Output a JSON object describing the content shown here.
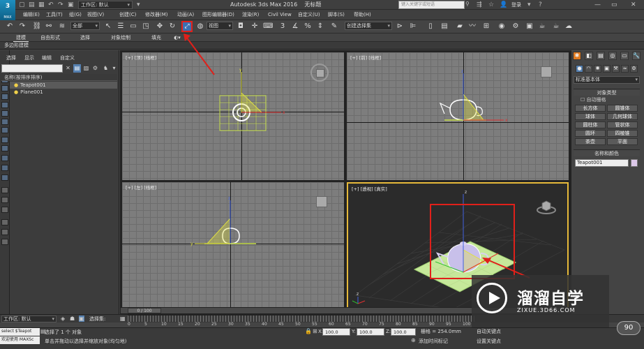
{
  "app": {
    "title": "Autodesk 3ds Max 2016",
    "doc_title": "无标题",
    "logo_text": "MAX",
    "workspace_label": "工作区: 默认",
    "search_placeholder": "键入关键字或短语",
    "login_label": "登录"
  },
  "menus": [
    "编辑(E)",
    "工具(T)",
    "组(G)",
    "视图(V)",
    "创建(C)",
    "修改器(M)",
    "动画(A)",
    "图形编辑器(D)",
    "渲染(R)",
    "Civil View",
    "自定义(U)",
    "脚本(S)",
    "帮助(H)"
  ],
  "toolbar": {
    "selection_filter": "全部",
    "ref_coord": "视图",
    "named_selection": "创建选择集",
    "highlighted_tool": "select-and-manipulate",
    "highlight_color": "#e0201a"
  },
  "ribbon": {
    "tabs": [
      "建模",
      "自由形式",
      "选择",
      "对象绘制",
      "填充"
    ],
    "active_tab": "建模",
    "sub_label": "多边形建模"
  },
  "scene_explorer": {
    "menu": [
      "选择",
      "显示",
      "编辑",
      "自定义"
    ],
    "column_header": "名称(按排序排序)",
    "items": [
      "Teapot001",
      "Plane001"
    ],
    "selected_item": "Teapot001"
  },
  "viewports": {
    "top": "[+] [顶] [线框]",
    "front": "[+] [前] [线框]",
    "left": "[+] [左] [线框]",
    "perspective": "[+] [透视] [真实]",
    "axis_labels": {
      "x": "x",
      "y": "y",
      "z": "z"
    },
    "active_border_color": "#e6b93a"
  },
  "command_panel": {
    "category": "标准基本体",
    "object_type_header": "对象类型",
    "autogrid_label": "自动栅格",
    "buttons": [
      "长方体",
      "圆锥体",
      "球体",
      "几何球体",
      "圆柱体",
      "管状体",
      "圆环",
      "四棱锥",
      "茶壶",
      "平面"
    ],
    "name_color_header": "名称和颜色",
    "object_name": "Teapot001",
    "object_color": "#dcc8e8"
  },
  "timeline": {
    "frame_indicator": "0 / 100",
    "ruler_ticks": [
      "0",
      "5",
      "10",
      "15",
      "20",
      "25",
      "30",
      "35",
      "40",
      "45",
      "50",
      "55",
      "60",
      "65",
      "70",
      "75",
      "80",
      "85",
      "90",
      "95",
      "100"
    ]
  },
  "status": {
    "maxscript_line1": "select $Teapot",
    "maxscript_line2": "欢迎使用 MAXSc",
    "selection_info": "选择了 1 个 对象",
    "prompt": "单击并拖动以选择并缩放对象(均匀地)",
    "x_label": "X:",
    "x_value": "100.0",
    "y_label": "Y:",
    "y_value": "100.0",
    "z_label": "Z:",
    "z_value": "100.0",
    "grid": "栅格 = 254.0mm",
    "add_time_tag": "添加时间标记",
    "auto_key": "自动关键点",
    "set_key": "设置关键点",
    "workspace_bottom": "工作区: 默认",
    "selection_set_label": "选择集:",
    "fps": "90"
  },
  "watermark": {
    "title": "溜溜自学",
    "url": "ZIXUE.3D66.COM"
  }
}
